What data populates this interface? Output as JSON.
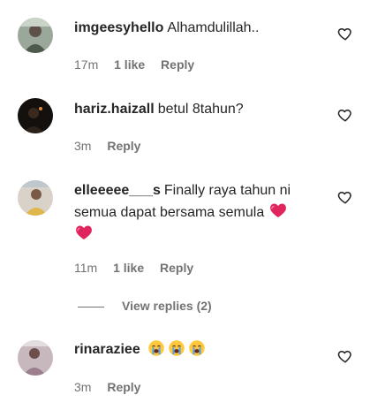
{
  "comments": [
    {
      "username": "imgeesyhello",
      "text": "Alhamdulillah..",
      "time": "17m",
      "likes": "1 like",
      "reply": "Reply",
      "avatar_color": "#8a9a8a"
    },
    {
      "username": "hariz.haizall",
      "text": "betul 8tahun?",
      "time": "3m",
      "reply": "Reply",
      "avatar_color": "#1a1410"
    },
    {
      "username": "elleeeee___s",
      "text": "Finally raya tahun ni semua dapat bersama semula",
      "time": "11m",
      "likes": "1 like",
      "reply": "Reply",
      "view_replies": "View replies (2)",
      "avatar_color": "#c9c2b8"
    },
    {
      "username": "rinaraziee",
      "text": "",
      "time": "3m",
      "reply": "Reply",
      "avatar_color": "#b9a6b0"
    }
  ],
  "colors": {
    "text": "#262626",
    "muted": "#737373",
    "heart": "#e0245e"
  },
  "icons": [
    "heart-outline-icon",
    "red-heart-emoji-icon",
    "crying-face-emoji-icon"
  ]
}
